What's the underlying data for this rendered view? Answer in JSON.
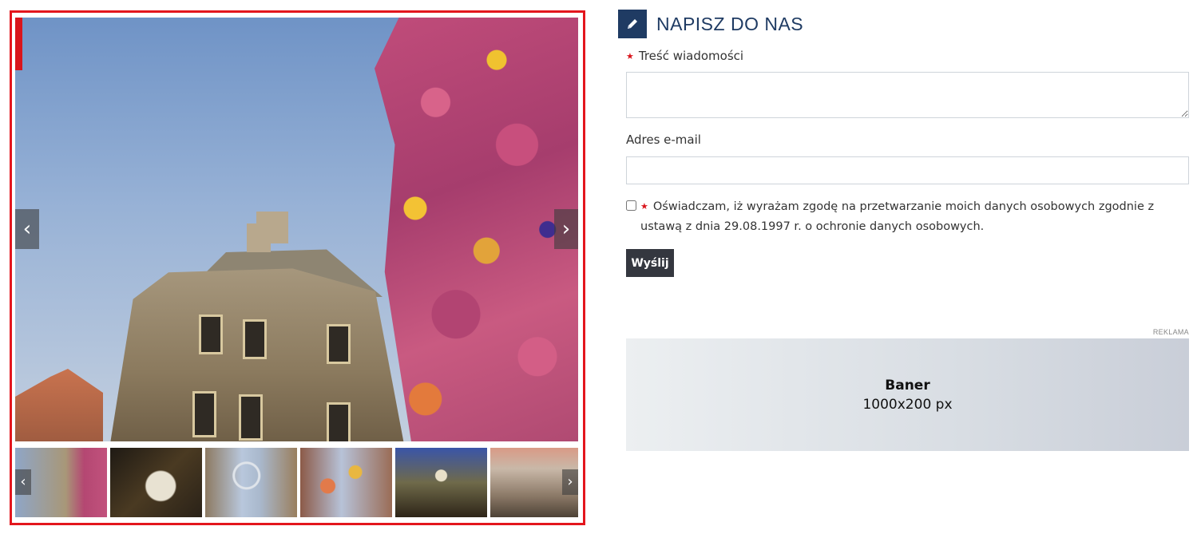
{
  "gallery": {
    "prev_arrow": "‹",
    "next_arrow": "›",
    "thumb_prev_arrow": "‹",
    "thumb_next_arrow": "›",
    "thumbnails": [
      {
        "name": "thumb-balloons-building"
      },
      {
        "name": "thumb-night-performer"
      },
      {
        "name": "thumb-dreamcatcher-street"
      },
      {
        "name": "thumb-hot-air-balloons-street"
      },
      {
        "name": "thumb-night-balloons-crowd"
      },
      {
        "name": "thumb-umbrellas-street"
      }
    ]
  },
  "form": {
    "title": "NAPISZ DO NAS",
    "required_mark": "★",
    "message_label": "Treść wiadomości",
    "email_label": "Adres e-mail",
    "consent_text": "Oświadczam, iż wyrażam zgodę na przetwarzanie moich danych osobowych zgodnie z ustawą z dnia 29.08.1997 r. o ochronie danych osobowych.",
    "submit_label": "Wyślij"
  },
  "ad": {
    "label": "REKLAMA",
    "banner_title": "Baner",
    "banner_size": "1000x200 px"
  },
  "colors": {
    "accent": "#1f3b63",
    "gallery_border": "#e3161d",
    "required": "#d9151c",
    "button": "#34373f"
  }
}
